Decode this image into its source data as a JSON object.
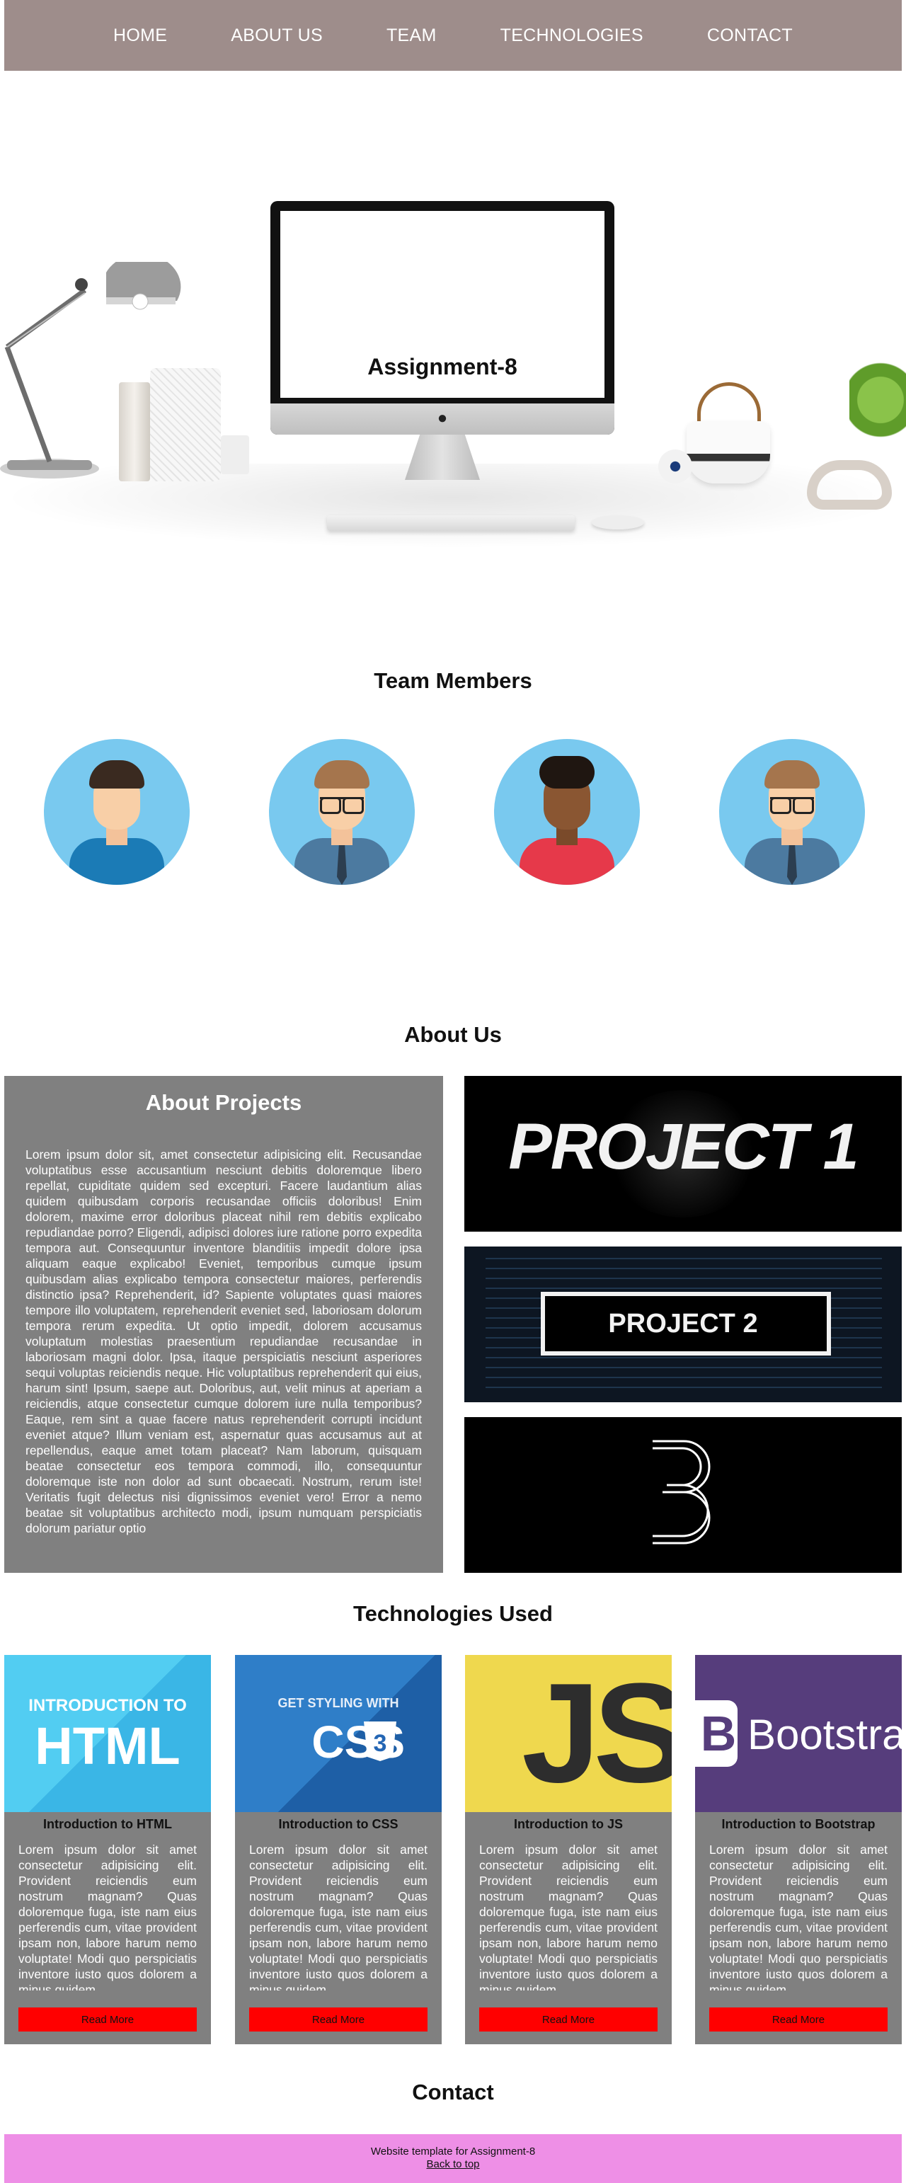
{
  "nav": {
    "items": [
      "HOME",
      "ABOUT US",
      "TEAM",
      "TECHNOLOGIES",
      "CONTACT"
    ]
  },
  "hero": {
    "title": "Assignment-8"
  },
  "team": {
    "title": "Team Members"
  },
  "about": {
    "title": "About Us",
    "panel_title": "About Projects",
    "text": "Lorem ipsum dolor sit, amet consectetur adipisicing elit. Recusandae voluptatibus esse accusantium nesciunt debitis doloremque libero repellat, cupiditate quidem sed excepturi. Facere laudantium alias quidem quibusdam corporis recusandae officiis doloribus! Enim dolorem, maxime error doloribus placeat nihil rem debitis explicabo repudiandae porro? Eligendi, adipisci dolores iure ratione porro expedita tempora aut. Consequuntur inventore blanditiis impedit dolore ipsa aliquam eaque explicabo! Eveniet, temporibus cumque ipsum quibusdam alias explicabo tempora consectetur maiores, perferendis distinctio ipsa? Reprehenderit, id? Sapiente voluptates quasi maiores tempore illo voluptatem, reprehenderit eveniet sed, laboriosam dolorum tempora rerum expedita. Ut optio impedit, dolorem accusamus voluptatum molestias praesentium repudiandae recusandae in laboriosam magni dolor. Ipsa, itaque perspiciatis nesciunt asperiores sequi voluptas reiciendis neque. Hic voluptatibus reprehenderit qui eius, harum sint! Ipsum, saepe aut. Doloribus, aut, velit minus at aperiam a reiciendis, atque consectetur cumque dolorem iure nulla temporibus? Eaque, rem sint a quae facere natus reprehenderit corrupti incidunt eveniet atque? Illum veniam est, aspernatur quas accusamus aut at repellendus, eaque amet totam placeat? Nam laborum, quisquam beatae consectetur eos tempora commodi, illo, consequuntur doloremque iste non dolor ad sunt obcaecati. Nostrum, rerum iste! Veritatis fugit delectus nisi dignissimos eveniet vero! Error a nemo beatae sit voluptatibus architecto modi, ipsum numquam perspiciatis dolorum pariatur optio",
    "projects": [
      "PROJECT 1",
      "PROJECT 2",
      "3"
    ]
  },
  "technologies": {
    "title": "Technologies Used",
    "cards": [
      {
        "image_top": "INTRODUCTION TO",
        "image_main": "HTML",
        "title": "Introduction to HTML",
        "text": "Lorem ipsum dolor sit amet consectetur adipisicing elit. Provident reiciendis eum nostrum magnam? Quas doloremque fuga, iste nam eius perferendis cum, vitae provident ipsam non, labore harum nemo voluptate! Modi quo perspiciatis inventore iusto quos dolorem a minus quidem",
        "button": "Read More",
        "image_color": "#44c1ee"
      },
      {
        "image_top": "GET STYLING WITH",
        "image_main": "CSS",
        "title": "Introduction to CSS",
        "text": "Lorem ipsum dolor sit amet consectetur adipisicing elit. Provident reiciendis eum nostrum magnam? Quas doloremque fuga, iste nam eius perferendis cum, vitae provident ipsam non, labore harum nemo voluptate! Modi quo perspiciatis inventore iusto quos dolorem a minus quidem",
        "button": "Read More",
        "image_color": "#2466b4"
      },
      {
        "image_top": "",
        "image_main": "JS",
        "title": "Introduction to JS",
        "text": "Lorem ipsum dolor sit amet consectetur adipisicing elit. Provident reiciendis eum nostrum magnam? Quas doloremque fuga, iste nam eius perferendis cum, vitae provident ipsam non, labore harum nemo voluptate! Modi quo perspiciatis inventore iusto quos dolorem a minus quidem",
        "button": "Read More",
        "image_color": "#efd84e"
      },
      {
        "image_top": "",
        "image_main": "Bootstra",
        "title": "Introduction to Bootstrap",
        "text": "Lorem ipsum dolor sit amet consectetur adipisicing elit. Provident reiciendis eum nostrum magnam? Quas doloremque fuga, iste nam eius perferendis cum, vitae provident ipsam non, labore harum nemo voluptate! Modi quo perspiciatis inventore iusto quos dolorem a minus quidem",
        "button": "Read More",
        "image_color": "#563d7c"
      }
    ]
  },
  "contact": {
    "title": "Contact"
  },
  "footer": {
    "text": "Website template for Assignment-8",
    "link": "Back to top"
  },
  "colors": {
    "nav_bg": "#9e8d8b",
    "panel_gray": "#808080",
    "button_red": "#ff0000",
    "footer_pink": "#ee8fe6",
    "avatar_bg": "#79c9ef"
  }
}
